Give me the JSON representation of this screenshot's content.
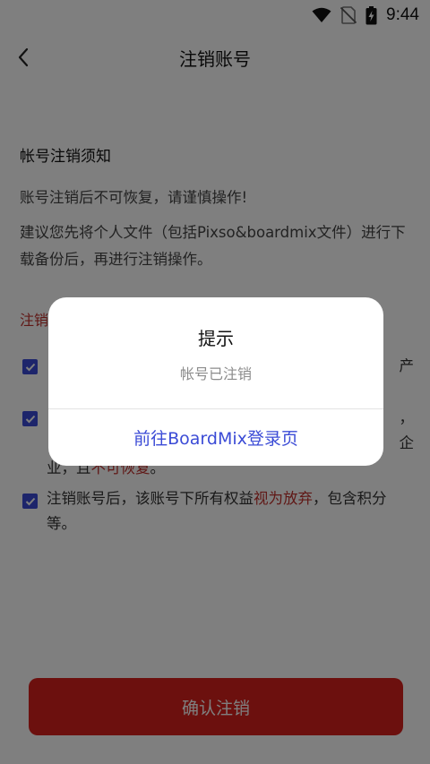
{
  "status_bar": {
    "time": "9:44",
    "icons": [
      "wifi-icon",
      "no-sim-icon",
      "battery-charging-icon"
    ]
  },
  "app_bar": {
    "back_icon": "chevron-left-icon",
    "title": "注销账号"
  },
  "notice": {
    "title": "帐号注销须知",
    "line1": "账号注销后不可恢复，请谨慎操作!",
    "line2": "建议您先将个人文件（包括Pixso&boardmix文件）进行下载备份后，再进行注销操作。"
  },
  "warning": {
    "title": "注销"
  },
  "checklist": [
    {
      "text_visible": "产"
    },
    {
      "line1": "，",
      "line2": "企",
      "line3_prefix": "业，且",
      "line3_red": "不可恢复",
      "line3_suffix": "。"
    },
    {
      "prefix": "注销账号后，该账号下所有权益",
      "red": "视为放弃",
      "suffix": "，包含积分等。"
    }
  ],
  "confirm_button": {
    "label": "确认注销"
  },
  "dialog": {
    "title": "提示",
    "message": "帐号已注销",
    "action_label": "前往BoardMix登录页"
  },
  "colors": {
    "accent_blue": "#3b4bd6",
    "danger_red": "#d9201c",
    "overlay": "rgba(0,0,0,0.5)"
  }
}
